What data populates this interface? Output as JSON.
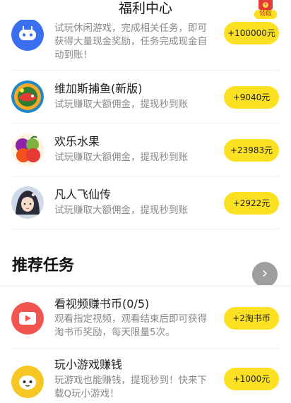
{
  "header": {
    "title": "福利中心",
    "redpack_label": "领取",
    "redpack_coin": "¥"
  },
  "task_list": [
    {
      "icon": "game-controller-icon",
      "title": "",
      "desc": "试玩休闲游戏，完成相关任务，即可获得大量现金奖励，任务完成现金自动到账！",
      "reward": "+100000元"
    },
    {
      "icon": "fishing-game-icon",
      "title": "维加斯捕鱼(新版)",
      "desc": "试玩赚取大额佣金，提现秒到账",
      "reward": "+9040元"
    },
    {
      "icon": "fruit-game-icon",
      "title": "欢乐水果",
      "desc": "试玩赚取大额佣金，提现秒到账",
      "reward": "+23983元"
    },
    {
      "icon": "fairy-game-icon",
      "title": "凡人飞仙传",
      "desc": "试玩赚取大额佣金，提现秒到账",
      "reward": "+2922元"
    }
  ],
  "recommended": {
    "title": "推荐任务",
    "items": [
      {
        "icon": "video-play-icon",
        "title": "看视频赚书币(0/5)",
        "desc": "观看指定视频，观看结束后即可获得淘书币奖励，每天限量5次。",
        "reward": "+2淘书币"
      },
      {
        "icon": "mini-game-icon",
        "title": "玩小游戏赚钱",
        "desc": "玩游戏也能赚钱，提现秒到！快来下载Q玩小游戏！",
        "reward": "+1000元"
      }
    ]
  },
  "colors": {
    "accent": "#fbe122",
    "video": "#f0554f",
    "mini_game": "#f6c623",
    "controller": "#3a6ff0"
  }
}
